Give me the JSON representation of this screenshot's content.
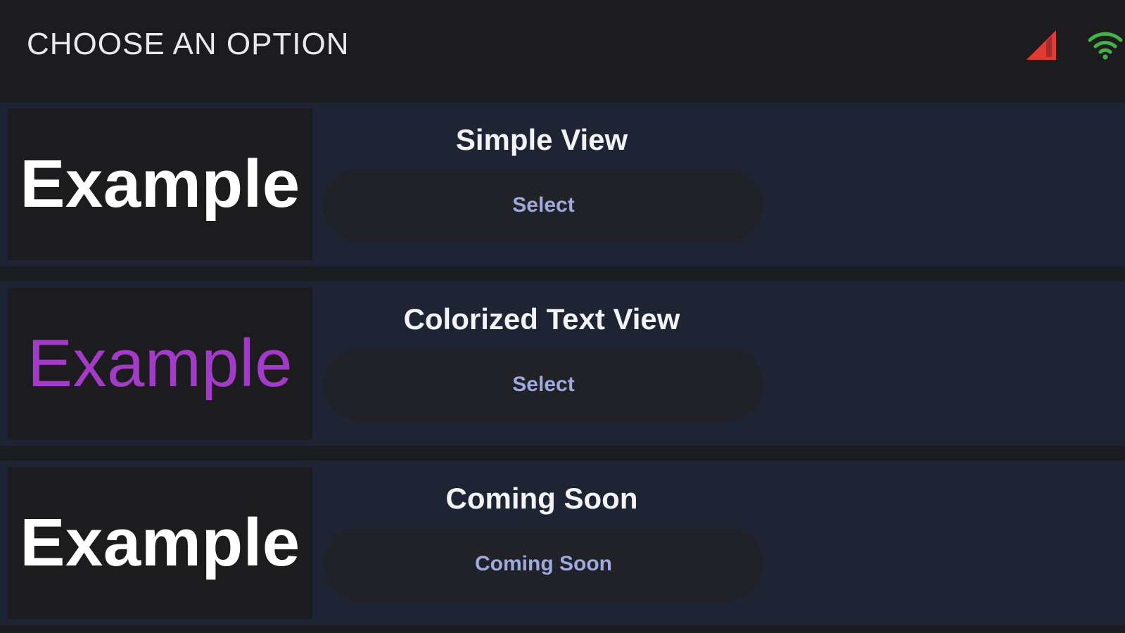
{
  "header": {
    "title": "CHOOSE AN OPTION",
    "status_icons": [
      {
        "name": "signal-icon",
        "color": "#e53935"
      },
      {
        "name": "wifi-icon",
        "color": "#43b347"
      }
    ]
  },
  "options": [
    {
      "preview_text": "Example",
      "preview_color": "#ffffff",
      "preview_weight": "bold",
      "title": "Simple View",
      "button_label": "Select",
      "button_label_color": "#9ea9dd"
    },
    {
      "preview_text": "Example",
      "preview_color": "#a43ac8",
      "preview_weight": "plain",
      "title": "Colorized Text View",
      "button_label": "Select",
      "button_label_color": "#9ea9dd"
    },
    {
      "preview_text": "Example",
      "preview_color": "#ffffff",
      "preview_weight": "bold",
      "title": "Coming Soon",
      "button_label": "Coming Soon",
      "button_label_color": "#9ea9dd"
    }
  ],
  "colors": {
    "background": "#1b1c1f",
    "row_background": "#1f2434",
    "button_background": "#212227"
  }
}
